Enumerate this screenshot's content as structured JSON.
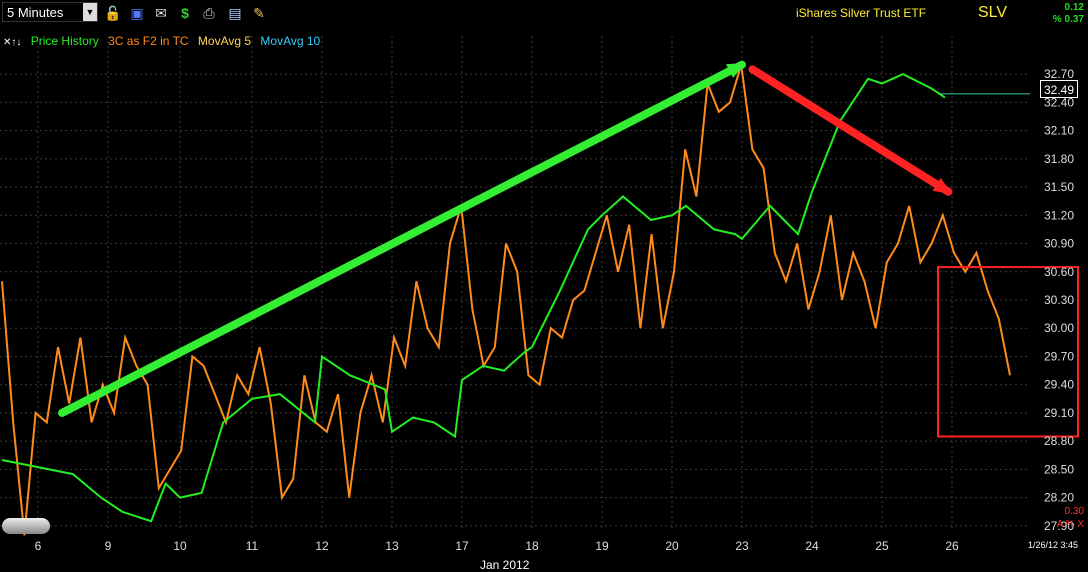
{
  "toolbar": {
    "timeframe": "5 Minutes",
    "icons": [
      "dropdown-icon",
      "lock-icon",
      "save-icon",
      "mail-icon",
      "dollar-icon",
      "print-icon",
      "card-icon",
      "pencil-icon"
    ]
  },
  "header": {
    "name": "iShares Silver Trust ETF",
    "symbol": "SLV",
    "change_abs": "0.12",
    "change_pct": "% 0.37"
  },
  "legend": {
    "items": [
      "Price History",
      "3C as F2 in TC",
      "MovAvg 5",
      "MovAvg 10"
    ]
  },
  "last_price": "32.49",
  "indicator": {
    "value": "0.30",
    "buttons": "A % X"
  },
  "datetime": "1/26/12 3:45",
  "month_label": "Jan 2012",
  "colors": {
    "price": "#22ee22",
    "indicator": "#ff8c1a",
    "ma5": "#ffd24d",
    "ma10": "#33ccff",
    "up_arrow": "#33ee33",
    "down_arrow": "#ff2222",
    "box": "#ff2222"
  },
  "chart_data": {
    "type": "line",
    "x_ticks": [
      "6",
      "9",
      "10",
      "11",
      "12",
      "13",
      "17",
      "18",
      "19",
      "20",
      "23",
      "24",
      "25",
      "26"
    ],
    "y_ticks": [
      "32.70",
      "32.40",
      "32.10",
      "31.80",
      "31.50",
      "31.20",
      "30.90",
      "30.60",
      "30.30",
      "30.00",
      "29.70",
      "29.40",
      "29.10",
      "28.80",
      "28.50",
      "28.20",
      "27.90"
    ],
    "ylim": [
      27.75,
      32.85
    ],
    "series": [
      {
        "name": "Price History",
        "x": [
          0,
          0.5,
          0.9,
          1.2,
          1.6,
          1.8,
          2.0,
          2.3,
          2.6,
          3.0,
          3.4,
          3.9,
          4.0,
          4.4,
          4.9,
          5.0,
          5.3,
          5.6,
          5.9,
          6.0,
          6.3,
          6.6,
          6.9,
          7.0,
          7.4,
          7.8,
          8.0,
          8.3,
          8.7,
          9.0,
          9.2,
          9.6,
          9.9,
          10.0,
          10.4,
          10.8,
          11.0,
          11.4,
          11.8,
          12.0,
          12.3,
          12.7,
          12.9
        ],
        "y": [
          28.6,
          28.45,
          28.2,
          28.05,
          27.95,
          28.35,
          28.2,
          28.25,
          29.0,
          29.25,
          29.3,
          29.0,
          29.7,
          29.5,
          29.35,
          28.9,
          29.05,
          29.0,
          28.85,
          29.45,
          29.6,
          29.55,
          29.75,
          29.8,
          30.4,
          31.05,
          31.2,
          31.4,
          31.15,
          31.2,
          31.3,
          31.05,
          31.0,
          30.95,
          31.3,
          31.0,
          31.45,
          32.2,
          32.65,
          32.6,
          32.7,
          32.55,
          32.45
        ]
      }
    ],
    "indicator_series": {
      "name": "3C as F2 in TC",
      "values": [
        30.5,
        29.0,
        27.8,
        29.1,
        29.0,
        29.8,
        29.2,
        29.9,
        29.0,
        29.4,
        29.1,
        29.9,
        29.6,
        29.4,
        28.3,
        28.5,
        28.7,
        29.7,
        29.6,
        29.3,
        29.0,
        29.5,
        29.3,
        29.8,
        29.2,
        28.2,
        28.4,
        29.5,
        29.0,
        28.9,
        29.3,
        28.2,
        29.1,
        29.5,
        29.0,
        29.9,
        29.6,
        30.5,
        30.0,
        29.8,
        30.9,
        31.3,
        30.2,
        29.6,
        29.8,
        30.9,
        30.6,
        29.5,
        29.4,
        30.0,
        29.9,
        30.3,
        30.4,
        30.8,
        31.2,
        30.6,
        31.1,
        30.0,
        31.0,
        30.0,
        30.6,
        31.9,
        31.4,
        32.6,
        32.3,
        32.4,
        32.8,
        31.9,
        31.7,
        30.8,
        30.5,
        30.9,
        30.2,
        30.6,
        31.2,
        30.3,
        30.8,
        30.5,
        30.0,
        30.7,
        30.9,
        31.3,
        30.7,
        30.9,
        31.2,
        30.8,
        30.6,
        30.8,
        30.4,
        30.1,
        29.5
      ]
    },
    "annotations": [
      {
        "type": "arrow",
        "color": "up",
        "from": [
          0.35,
          29.1
        ],
        "to": [
          10.0,
          32.8
        ]
      },
      {
        "type": "arrow",
        "color": "down",
        "from": [
          10.15,
          32.75
        ],
        "to": [
          12.95,
          31.45
        ]
      },
      {
        "type": "box",
        "x": [
          12.9,
          14.2
        ],
        "y": [
          28.85,
          30.65
        ]
      }
    ]
  }
}
